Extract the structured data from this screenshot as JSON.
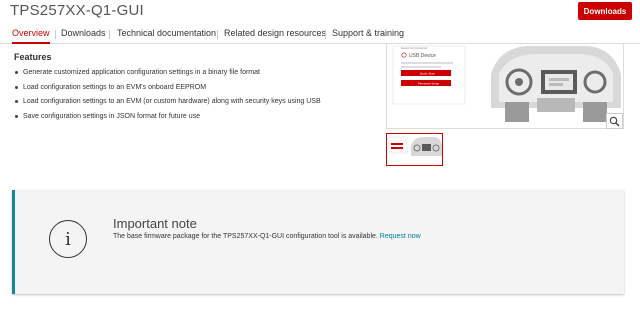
{
  "header": {
    "title": "TPS257XX-Q1-GUI",
    "downloads_button": "Downloads"
  },
  "tabs": [
    {
      "label": "Overview",
      "active": true
    },
    {
      "label": "Downloads",
      "active": false
    },
    {
      "label": "Technical documentation",
      "active": false
    },
    {
      "label": "Related design resources",
      "active": false
    },
    {
      "label": "Support & training",
      "active": false
    }
  ],
  "features": {
    "heading": "Features",
    "items": [
      "Generate customized application configuration settings in a binary file format",
      "Load configuration settings to an EVM's onboard EEPROM",
      "Load configuration settings to an EVM (or custom hardware) along with security keys using USB",
      "Save configuration settings in JSON format for future use"
    ]
  },
  "preview": {
    "screen_heading": "Device Not Connected",
    "screen_title": "USB Device",
    "screen_button_1": "Quick Start",
    "screen_button_2": "Firmware Setup",
    "zoom_icon": "magnifier-icon"
  },
  "note": {
    "title": "Important note",
    "text": "The base firmware package for the TPS257XX-Q1-GUI configuration tool is available.",
    "link": "Request now",
    "icon": "info-icon"
  },
  "colors": {
    "brand_red": "#cc0000",
    "note_accent": "#118899",
    "link": "#007c9c"
  }
}
